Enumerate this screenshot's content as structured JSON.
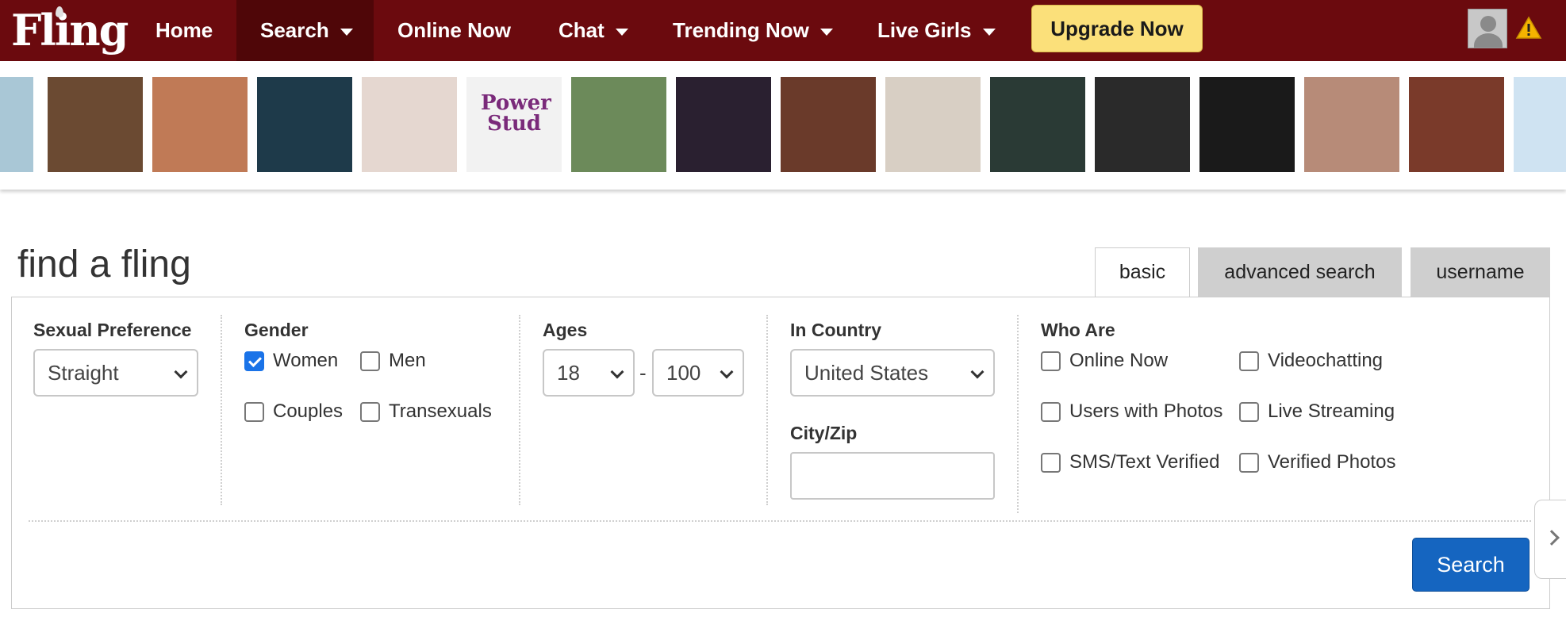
{
  "nav": {
    "logo": "Fling",
    "items": [
      {
        "label": "Home",
        "dropdown": false
      },
      {
        "label": "Search",
        "dropdown": true,
        "active": true
      },
      {
        "label": "Online Now",
        "dropdown": false
      },
      {
        "label": "Chat",
        "dropdown": true
      },
      {
        "label": "Trending Now",
        "dropdown": true
      },
      {
        "label": "Live Girls",
        "dropdown": true
      }
    ],
    "upgrade_label": "Upgrade Now",
    "avatar_icon": "user-avatar-icon",
    "alert_icon": "warning-icon",
    "colors": {
      "bar": "#6b0a0e",
      "active": "#4f0608",
      "upgrade": "#fbe07a"
    }
  },
  "photo_strip": {
    "thumbnails": [
      {
        "color": "#a9c7d6"
      },
      {
        "color": "#6b4a32"
      },
      {
        "color": "#c07a56"
      },
      {
        "color": "#1e3a4a"
      },
      {
        "color": "#e5d7d0"
      },
      {
        "color": "#f2f2f2",
        "text": "Power Stud"
      },
      {
        "color": "#6c8a5a"
      },
      {
        "color": "#2a2030"
      },
      {
        "color": "#6a3a2a"
      },
      {
        "color": "#d8cfc4"
      },
      {
        "color": "#2a3a35"
      },
      {
        "color": "#2a2a2a"
      },
      {
        "color": "#1a1a1a"
      },
      {
        "color": "#b78b78"
      },
      {
        "color": "#7a3a2a"
      },
      {
        "color": "#cfe3f2"
      }
    ]
  },
  "search": {
    "title": "find a fling",
    "tabs": [
      {
        "label": "basic",
        "active": true
      },
      {
        "label": "advanced search",
        "active": false
      },
      {
        "label": "username",
        "active": false
      }
    ],
    "sexual_preference": {
      "label": "Sexual Preference",
      "value": "Straight"
    },
    "gender": {
      "label": "Gender",
      "options": [
        {
          "label": "Women",
          "checked": true
        },
        {
          "label": "Men",
          "checked": false
        },
        {
          "label": "Couples",
          "checked": false
        },
        {
          "label": "Transexuals",
          "checked": false
        }
      ]
    },
    "ages": {
      "label": "Ages",
      "min": "18",
      "separator": "-",
      "max": "100"
    },
    "country": {
      "label": "In Country",
      "value": "United States"
    },
    "city": {
      "label": "City/Zip",
      "value": ""
    },
    "who_are": {
      "label": "Who Are",
      "options": [
        {
          "label": "Online Now",
          "checked": false
        },
        {
          "label": "Videochatting",
          "checked": false
        },
        {
          "label": "Users with Photos",
          "checked": false
        },
        {
          "label": "Live Streaming",
          "checked": false
        },
        {
          "label": "SMS/Text Verified",
          "checked": false
        },
        {
          "label": "Verified Photos",
          "checked": false
        }
      ]
    },
    "button_label": "Search",
    "side_arrow_icon": "chevron-right-icon",
    "colors": {
      "button": "#1565c0",
      "checkbox_checked": "#1a73e8"
    }
  }
}
